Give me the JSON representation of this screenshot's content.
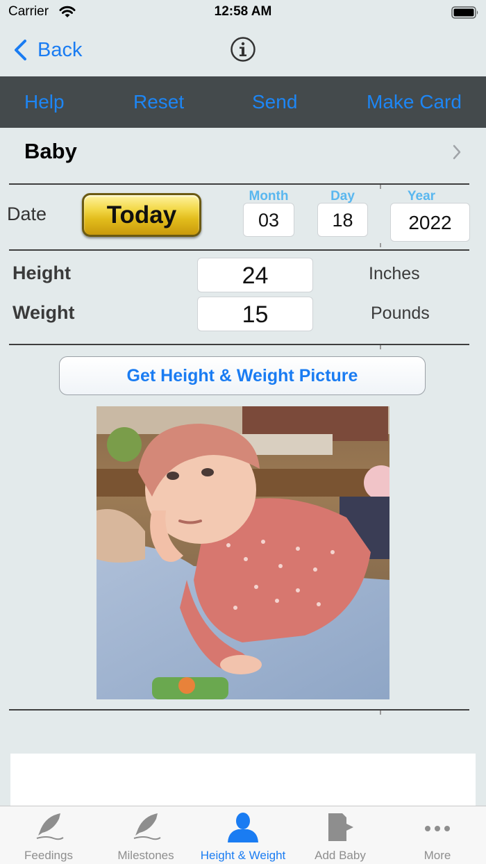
{
  "status_bar": {
    "carrier": "Carrier",
    "time": "12:58 AM"
  },
  "nav": {
    "back_label": "Back",
    "info_icon": "info-circle-icon"
  },
  "toolbar": {
    "help": "Help",
    "reset": "Reset",
    "send": "Send",
    "make_card": "Make Card"
  },
  "baby": {
    "name": "Baby"
  },
  "date": {
    "label": "Date",
    "today_button": "Today",
    "month_label": "Month",
    "month_value": "03",
    "day_label": "Day",
    "day_value": "18",
    "year_label": "Year",
    "year_value": "2022"
  },
  "measurements": {
    "height_label": "Height",
    "height_value": "24",
    "height_unit": "Inches",
    "weight_label": "Weight",
    "weight_value": "15",
    "weight_unit": "Pounds"
  },
  "picture_button": "Get Height & Weight Picture",
  "tabs": [
    {
      "label": "Feedings",
      "icon": "quill-icon",
      "active": false
    },
    {
      "label": "Milestones",
      "icon": "quill-icon",
      "active": false
    },
    {
      "label": "Height & Weight",
      "icon": "person-icon",
      "active": true
    },
    {
      "label": "Add Baby",
      "icon": "add-document-icon",
      "active": false
    },
    {
      "label": "More",
      "icon": "more-dots-icon",
      "active": false
    }
  ],
  "colors": {
    "accent": "#1a7cf2",
    "toolbar_bg": "#444a4c",
    "toolbar_text": "#1d86f5",
    "date_header": "#5ab7ef",
    "today_button": "#e2bd1c",
    "background": "#e3eaeb"
  }
}
